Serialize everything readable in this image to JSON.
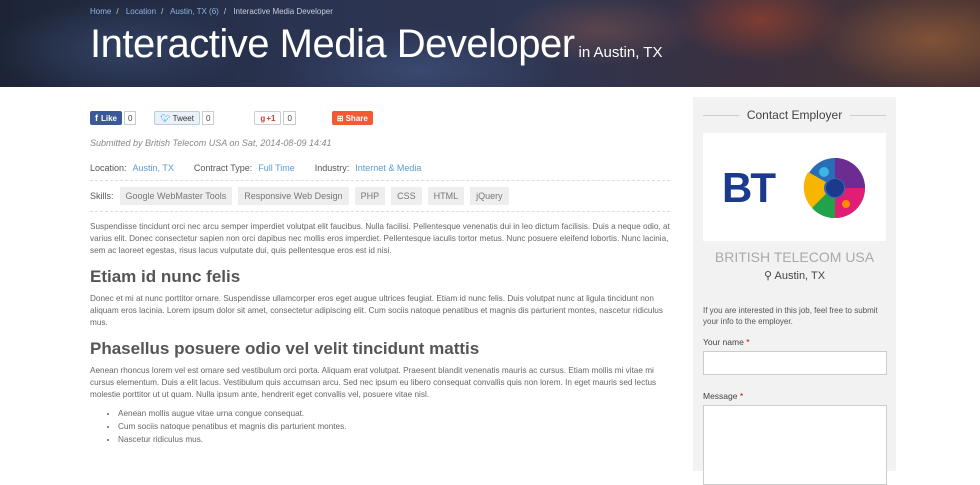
{
  "breadcrumb": {
    "items": [
      "Home",
      "Location",
      "Austin, TX (6)",
      "Interactive Media Developer"
    ]
  },
  "hero": {
    "title": "Interactive Media Developer",
    "location": "in Austin, TX"
  },
  "share": {
    "facebook": {
      "label": "Like",
      "count": "0"
    },
    "twitter": {
      "label": "Tweet",
      "count": "0"
    },
    "googleplus": {
      "label": "+1",
      "count": "0"
    },
    "share": {
      "label": "Share"
    }
  },
  "submitted": "Submitted by British Telecom USA on Sat, 2014-08-09 14:41",
  "meta": {
    "location_label": "Location:",
    "location": "Austin, TX",
    "contract_label": "Contract Type:",
    "contract": "Full Time",
    "industry_label": "Industry:",
    "industry": "Internet & Media"
  },
  "skills": {
    "label": "Skills:",
    "items": [
      "Google WebMaster Tools",
      "Responsive Web Design",
      "PHP",
      "CSS",
      "HTML",
      "jQuery"
    ]
  },
  "content": {
    "p1": "Suspendisse tincidunt orci nec arcu semper imperdiet volutpat elit faucibus. Nulla facilisi. Pellentesque venenatis dui in leo dictum facilisis. Duis a neque odio, at varius elit. Donec consectetur sapien non orci dapibus nec mollis eros imperdiet. Pellentesque iaculis tortor metus. Nunc posuere eleifend lobortis. Nunc lacinia, sem ac laoreet egestas, risus lacus vulputate dui, quis pellentesque eros est id nisi.",
    "h1": "Etiam id nunc felis",
    "p2": "Donec et mi at nunc porttitor ornare. Suspendisse ullamcorper eros eget augue ultrices feugiat. Etiam id nunc felis. Duis volutpat nunc at ligula tincidunt non aliquam eros lacinia. Lorem ipsum dolor sit amet, consectetur adipiscing elit. Cum sociis natoque penatibus et magnis dis parturient montes, nascetur ridiculus mus.",
    "h2": "Phasellus posuere odio vel velit tincidunt mattis",
    "p3": "Aenean rhoncus lorem vel est ornare sed vestibulum orci porta. Aliquam erat volutpat. Praesent blandit venenatis mauris ac cursus. Etiam mollis mi vitae mi cursus elementum. Duis a elit lacus. Vestibulum quis accumsan arcu. Sed nec ipsum eu libero consequat convallis quis non lorem. In eget mauris sed lectus molestie porttitor ut ut quam. Nulla ipsum ante, hendrerit eget convallis vel, posuere vitae nisl.",
    "bullets": [
      "Aenean mollis augue vitae urna congue consequat.",
      "Cum sociis natoque penatibus et magnis dis parturient montes.",
      "Nascetur ridiculus mus."
    ]
  },
  "sidebar": {
    "title": "Contact Employer",
    "logo_text": "BT",
    "company": "BRITISH TELECOM USA",
    "location": "Austin, TX",
    "note": "If you are interested in this job, feel free to submit your info to the employer.",
    "name_label": "Your name",
    "message_label": "Message",
    "required_mark": "*"
  },
  "colors": {
    "link": "#5b9bd5",
    "bt_blue": "#1b3a8c",
    "accent_red": "#c00"
  }
}
